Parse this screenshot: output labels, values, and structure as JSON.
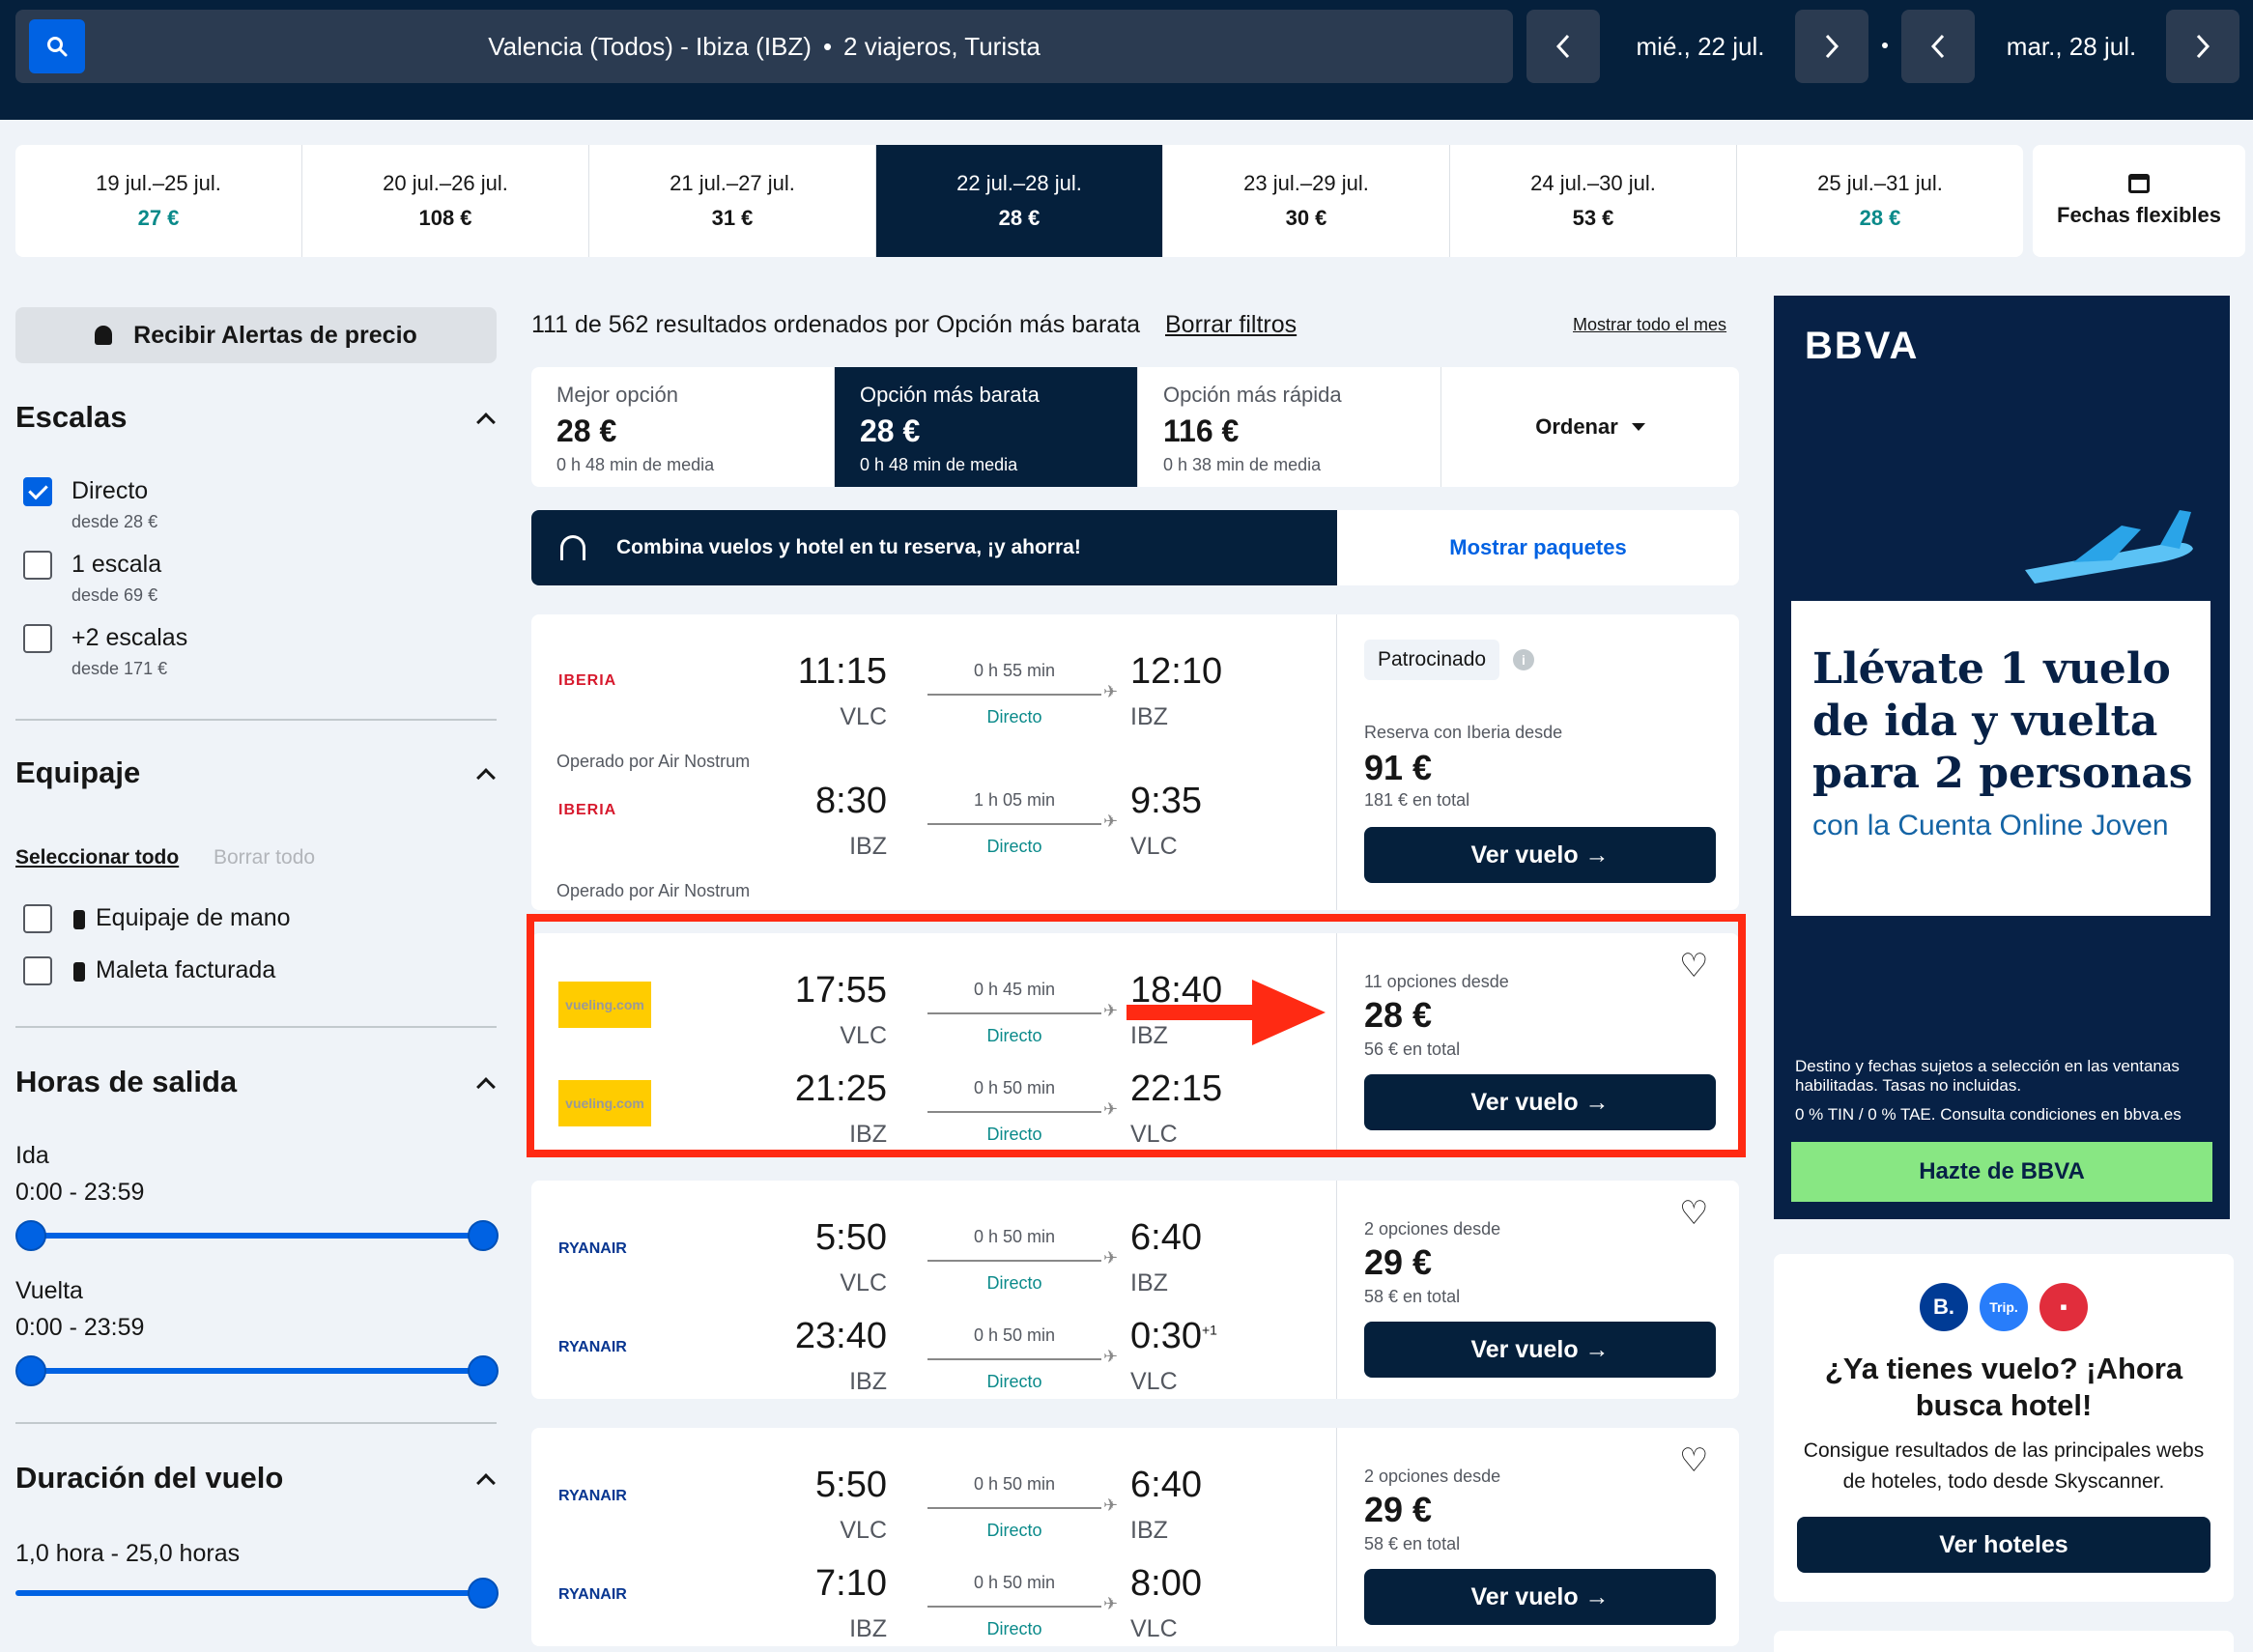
{
  "search": {
    "summary_route": "Valencia (Todos) - Ibiza (IBZ)",
    "summary_dot": "•",
    "summary_pax": "2 viajeros, Turista",
    "outbound_date": "mié., 22 jul.",
    "return_date": "mar., 28 jul."
  },
  "date_strip": [
    {
      "range": "19 jul.–25 jul.",
      "price": "27 €",
      "cheap": true
    },
    {
      "range": "20 jul.–26 jul.",
      "price": "108 €",
      "cheap": false
    },
    {
      "range": "21 jul.–27 jul.",
      "price": "31 €",
      "cheap": false
    },
    {
      "range": "22 jul.–28 jul.",
      "price": "28 €",
      "cheap": false,
      "active": true
    },
    {
      "range": "23 jul.–29 jul.",
      "price": "30 €",
      "cheap": false
    },
    {
      "range": "24 jul.–30 jul.",
      "price": "53 €",
      "cheap": false
    },
    {
      "range": "25 jul.–31 jul.",
      "price": "28 €",
      "cheap": true
    }
  ],
  "flex_dates_label": "Fechas flexibles",
  "sidebar": {
    "alert_label": "Recibir Alertas de precio",
    "stops_title": "Escalas",
    "stops": [
      {
        "label": "Directo",
        "sub": "desde 28 €",
        "checked": true
      },
      {
        "label": "1 escala",
        "sub": "desde 69 €",
        "checked": false
      },
      {
        "label": "+2 escalas",
        "sub": "desde 171 €",
        "checked": false
      }
    ],
    "baggage_title": "Equipaje",
    "select_all": "Seleccionar todo",
    "clear_all": "Borrar todo",
    "baggage": [
      {
        "label": "Equipaje de mano"
      },
      {
        "label": "Maleta facturada"
      }
    ],
    "departure_title": "Horas de salida",
    "outbound_label": "Ida",
    "outbound_range": "0:00 - 23:59",
    "return_label": "Vuelta",
    "return_range": "0:00 - 23:59",
    "duration_title": "Duración del vuelo",
    "duration_range": "1,0 hora - 25,0 horas"
  },
  "results": {
    "count_text": "111 de 562 resultados ordenados por Opción más barata",
    "clear_filters": "Borrar filtros",
    "show_month": "Mostrar todo el mes",
    "tabs": [
      {
        "label": "Mejor opción",
        "price": "28 €",
        "duration": "0 h 48 min de media"
      },
      {
        "label": "Opción más barata",
        "price": "28 €",
        "duration": "0 h 48 min de media",
        "active": true
      },
      {
        "label": "Opción más rápida",
        "price": "116 €",
        "duration": "0 h 38 min de media"
      }
    ],
    "order_label": "Ordenar",
    "promo_text": "Combina vuelos y hotel en tu reserva, ¡y ahorra!",
    "promo_link": "Mostrar paquetes",
    "direct_label": "Directo",
    "view_label": "Ver vuelo →",
    "cards": [
      {
        "airline": "IBERIA",
        "operated": "Operado por Air Nostrum",
        "legs": [
          {
            "dep": "11:15",
            "from": "VLC",
            "dur": "0 h 55 min",
            "arr": "12:10",
            "to": "IBZ"
          },
          {
            "dep": "8:30",
            "from": "IBZ",
            "dur": "1 h 05 min",
            "arr": "9:35",
            "to": "VLC"
          }
        ],
        "sponsored": "Patrocinado",
        "options": "Reserva con Iberia desde",
        "price": "91 €",
        "total": "181 € en total"
      },
      {
        "airline": "vueling.com",
        "legs": [
          {
            "dep": "17:55",
            "from": "VLC",
            "dur": "0 h 45 min",
            "arr": "18:40",
            "to": "IBZ"
          },
          {
            "dep": "21:25",
            "from": "IBZ",
            "dur": "0 h 50 min",
            "arr": "22:15",
            "to": "VLC"
          }
        ],
        "options": "11 opciones desde",
        "price": "28 €",
        "total": "56 € en total"
      },
      {
        "airline": "RYANAIR",
        "legs": [
          {
            "dep": "5:50",
            "from": "VLC",
            "dur": "0 h 50 min",
            "arr": "6:40",
            "to": "IBZ"
          },
          {
            "dep": "23:40",
            "from": "IBZ",
            "dur": "0 h 50 min",
            "arr": "0:30",
            "to": "VLC",
            "plus": "+1"
          }
        ],
        "options": "2 opciones desde",
        "price": "29 €",
        "total": "58 € en total"
      },
      {
        "airline": "RYANAIR",
        "legs": [
          {
            "dep": "5:50",
            "from": "VLC",
            "dur": "0 h 50 min",
            "arr": "6:40",
            "to": "IBZ"
          },
          {
            "dep": "7:10",
            "from": "IBZ",
            "dur": "0 h 50 min",
            "arr": "8:00",
            "to": "VLC"
          }
        ],
        "options": "2 opciones desde",
        "price": "29 €",
        "total": "58 € en total"
      }
    ]
  },
  "ad_bbva": {
    "logo": "BBVA",
    "headline": "Llévate 1 vuelo de ida y vuelta para 2 personas",
    "sub": "con la Cuenta Online Joven",
    "fine": "Destino y fechas sujetos a selección en las ventanas habilitadas. Tasas no incluidas.",
    "fine2": "0 % TIN / 0 % TAE. Consulta condiciones en bbva.es",
    "button": "Hazte de BBVA"
  },
  "ad_hotel": {
    "icons": [
      "B.",
      "Trip.",
      "▪"
    ],
    "title": "¿Ya tienes vuelo? ¡Ahora busca hotel!",
    "text": "Consigue resultados de las principales webs de hoteles, todo desde Skyscanner.",
    "button": "Ver hoteles"
  },
  "colors": {
    "navy": "#05203c",
    "blue": "#0062e3",
    "highlight": "#ff2a13",
    "teal": "#0a8a8a"
  }
}
